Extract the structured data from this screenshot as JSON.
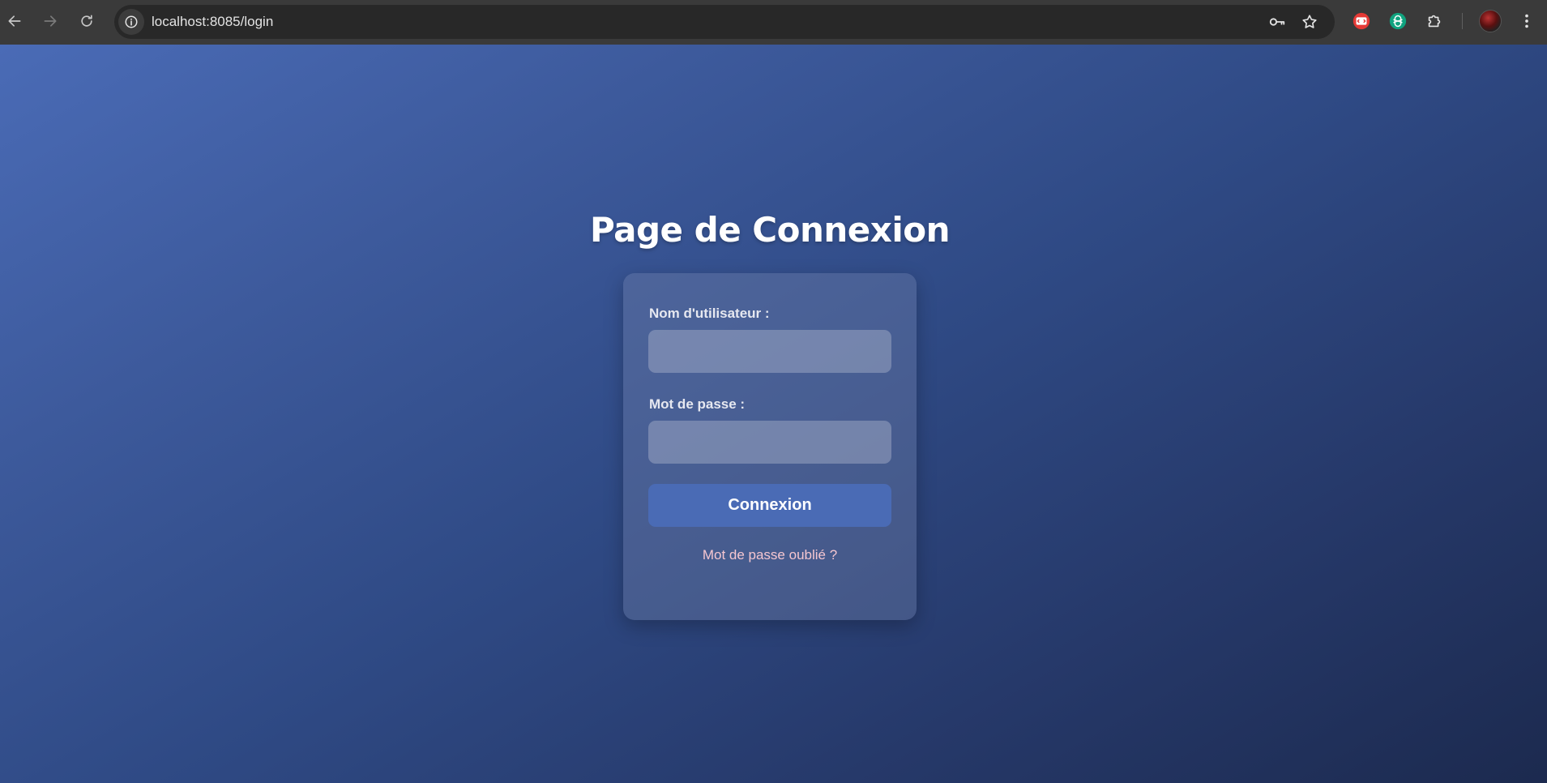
{
  "browser": {
    "url": "localhost:8085/login",
    "icons": {
      "back": "arrow-left-icon",
      "forward": "arrow-right-icon",
      "reload": "reload-icon",
      "site_info": "info-icon",
      "password": "key-icon",
      "bookmark": "star-icon",
      "extension_1": "code-extension-icon",
      "extension_2": "chatgpt-extension-icon",
      "extensions": "puzzle-icon",
      "menu": "kebab-menu-icon"
    }
  },
  "page": {
    "title": "Page de Connexion",
    "form": {
      "username_label": "Nom d'utilisateur :",
      "username_value": "",
      "password_label": "Mot de passe :",
      "password_value": "",
      "submit_label": "Connexion",
      "forgot_label": "Mot de passe oublié ?"
    }
  },
  "colors": {
    "background_start": "#4a6bb6",
    "background_end": "#1c2a4f",
    "button": "#4a6bb5",
    "link": "#f4c6d0"
  }
}
